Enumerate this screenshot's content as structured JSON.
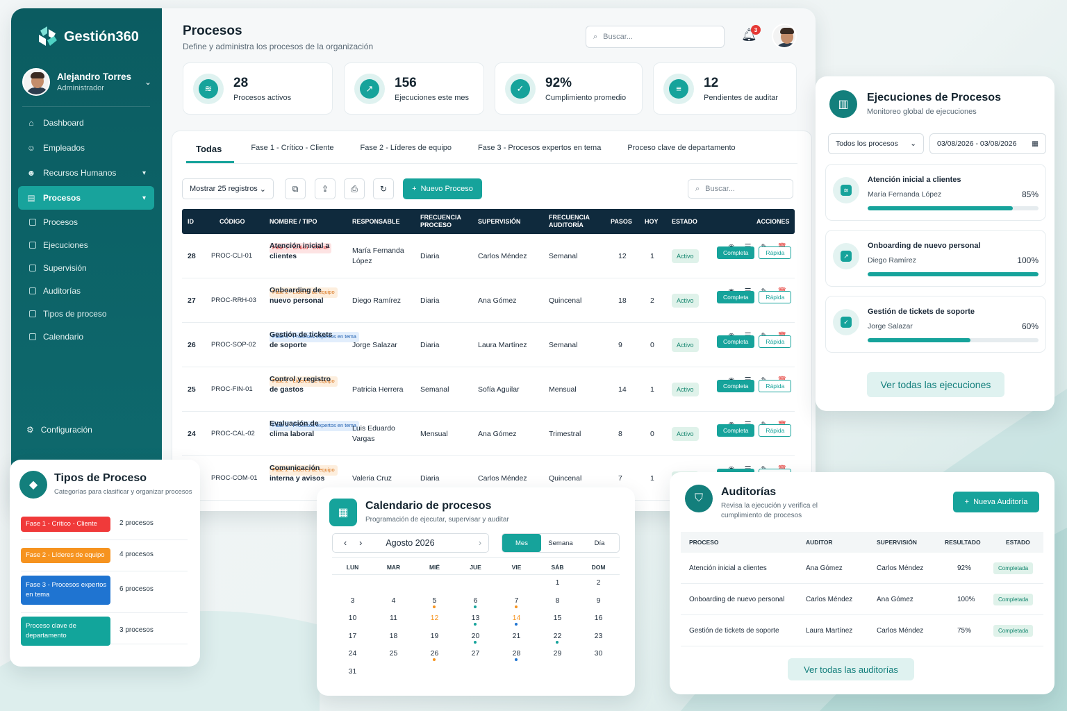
{
  "brand": {
    "name": "Gestión360",
    "accent": "#16a39b",
    "dark": "#0b5c61"
  },
  "user": {
    "name": "Alejandro Torres",
    "role": "Administrador"
  },
  "nav": [
    {
      "label": "Dashboard",
      "icon": "home-icon"
    },
    {
      "label": "Empleados",
      "icon": "users-icon"
    },
    {
      "label": "Recursos Humanos",
      "icon": "hr-icon"
    },
    {
      "label": "Procesos",
      "icon": "process-icon",
      "active": true
    }
  ],
  "subnav": [
    "Procesos",
    "Ejecuciones",
    "Supervisión",
    "Auditorías",
    "Tipos de proceso",
    "Calendario"
  ],
  "config_label": "Configuración",
  "header": {
    "title": "Procesos",
    "subtitle": "Define y administra los procesos de la organización",
    "search_placeholder": "Buscar...",
    "notifications": "3"
  },
  "stats": [
    {
      "value": "28",
      "label": "Procesos activos"
    },
    {
      "value": "156",
      "label": "Ejecuciones este mes"
    },
    {
      "value": "92%",
      "label": "Cumplimiento promedio"
    },
    {
      "value": "12",
      "label": "Pendientes de auditar"
    }
  ],
  "tabs": [
    "Todas",
    "Fase 1 - Crítico - Cliente",
    "Fase 2 - Líderes de equipo",
    "Fase 3 - Procesos expertos en tema",
    "Proceso clave de departamento"
  ],
  "toolbar": {
    "show": "Mostrar 25 registros",
    "new_button": "Nuevo Proceso",
    "search_placeholder": "Buscar..."
  },
  "table": {
    "headers": [
      "ID",
      "CÓDIGO",
      "NOMBRE / TIPO",
      "RESPONSABLE",
      "FRECUENCIA PROCESO",
      "SUPERVISIÓN",
      "FRECUENCIA AUDITORÍA",
      "PASOS",
      "HOY",
      "ESTADO",
      "ACCIONES"
    ],
    "rows": [
      {
        "id": "28",
        "code": "PROC-CLI-01",
        "name": "Atención inicial a clientes",
        "tag": "Fase 1 - Crítico - Cliente",
        "tagc": "red",
        "resp": "María Fernanda López",
        "freq": "Diaria",
        "sup": "Carlos Méndez",
        "aud": "Semanal",
        "steps": "12",
        "today": "1",
        "status": "Activo"
      },
      {
        "id": "27",
        "code": "PROC-RRH-03",
        "name": "Onboarding de nuevo personal",
        "tag": "Fase 2 - Líderes de equipo",
        "tagc": "orange",
        "resp": "Diego Ramírez",
        "freq": "Diaria",
        "sup": "Ana Gómez",
        "aud": "Quincenal",
        "steps": "18",
        "today": "2",
        "status": "Activo"
      },
      {
        "id": "26",
        "code": "PROC-SOP-02",
        "name": "Gestión de tickets de soporte",
        "tag": "Fase 3 - Procesos expertos en tema",
        "tagc": "blue",
        "resp": "Jorge Salazar",
        "freq": "Diaria",
        "sup": "Laura Martínez",
        "aud": "Semanal",
        "steps": "9",
        "today": "0",
        "status": "Activo"
      },
      {
        "id": "25",
        "code": "PROC-FIN-01",
        "name": "Control y registro de gastos",
        "tag": "Fase 2 - Líderes de equipo",
        "tagc": "orange",
        "resp": "Patricia Herrera",
        "freq": "Semanal",
        "sup": "Sofía Aguilar",
        "aud": "Mensual",
        "steps": "14",
        "today": "1",
        "status": "Activo"
      },
      {
        "id": "24",
        "code": "PROC-CAL-02",
        "name": "Evaluación de clima laboral",
        "tag": "Fase 3 - Procesos expertos en tema",
        "tagc": "blue",
        "resp": "Luis Eduardo Vargas",
        "freq": "Mensual",
        "sup": "Ana Gómez",
        "aud": "Trimestral",
        "steps": "8",
        "today": "0",
        "status": "Activo"
      },
      {
        "id": "",
        "code": "PROC-COM-01",
        "name": "Comunicación interna y avisos",
        "tag": "Fase 2 - Líderes de equipo",
        "tagc": "orange",
        "resp": "Valeria Cruz",
        "freq": "Diaria",
        "sup": "Carlos Méndez",
        "aud": "Quincenal",
        "steps": "7",
        "today": "1",
        "status": "Activo"
      }
    ],
    "btn_complete": "Completa",
    "btn_quick": "Rápida"
  },
  "executions": {
    "title": "Ejecuciones de Procesos",
    "subtitle": "Monitoreo global de ejecuciones",
    "filter": "Todos los procesos",
    "date": "03/08/2026 - 03/08/2026",
    "items": [
      {
        "name": "Atención inicial a clientes",
        "person": "María Fernanda López",
        "pct_label": "85%",
        "pct": 85
      },
      {
        "name": "Onboarding de nuevo personal",
        "person": "Diego Ramírez",
        "pct_label": "100%",
        "pct": 100
      },
      {
        "name": "Gestión de tickets de soporte",
        "person": "Jorge Salazar",
        "pct_label": "60%",
        "pct": 60
      }
    ],
    "view_all": "Ver todas las ejecuciones"
  },
  "types": {
    "title": "Tipos de Proceso",
    "subtitle": "Categorías para clasificar y organizar procesos",
    "items": [
      {
        "label": "Fase 1 - Crítico - Cliente",
        "count": "2 procesos",
        "color": "#f03a3a"
      },
      {
        "label": "Fase 2 - Líderes de equipo",
        "count": "4 procesos",
        "color": "#f6931f"
      },
      {
        "label": "Fase 3 - Procesos expertos en tema",
        "count": "6 procesos",
        "color": "#1f74d1"
      },
      {
        "label": "Proceso clave de departamento",
        "count": "3 procesos",
        "color": "#12a59b"
      }
    ]
  },
  "calendar": {
    "title": "Calendario de procesos",
    "subtitle": "Programación de ejecutar, supervisar y auditar",
    "month": "Agosto 2026",
    "views": [
      "Mes",
      "Semana",
      "Día"
    ],
    "weekdays": [
      "LUN",
      "MAR",
      "MIÉ",
      "JUE",
      "VIE",
      "SÁB",
      "DOM"
    ],
    "weeks": [
      [
        {
          "d": ""
        },
        {
          "d": ""
        },
        {
          "d": ""
        },
        {
          "d": ""
        },
        {
          "d": ""
        },
        {
          "d": "1"
        },
        {
          "d": "2"
        }
      ],
      [
        {
          "d": "3"
        },
        {
          "d": "4"
        },
        {
          "d": "5",
          "dot": "#f6931f"
        },
        {
          "d": "6",
          "dot": "#16a39b"
        },
        {
          "d": "7",
          "dot": "#f6931f"
        },
        {
          "d": "8"
        },
        {
          "d": "9"
        }
      ],
      [
        {
          "d": "10"
        },
        {
          "d": "11"
        },
        {
          "d": "12",
          "hl": "#f6931f"
        },
        {
          "d": "13",
          "dot": "#16a39b"
        },
        {
          "d": "14",
          "hl": "#f6931f",
          "dot": "#1f74d1"
        },
        {
          "d": "15"
        },
        {
          "d": "16"
        }
      ],
      [
        {
          "d": "17"
        },
        {
          "d": "18"
        },
        {
          "d": "19"
        },
        {
          "d": "20",
          "dot": "#16a39b"
        },
        {
          "d": "21"
        },
        {
          "d": "22",
          "dot": "#16a39b"
        },
        {
          "d": "23"
        }
      ],
      [
        {
          "d": "24"
        },
        {
          "d": "25"
        },
        {
          "d": "26",
          "dot": "#f6931f"
        },
        {
          "d": "27"
        },
        {
          "d": "28",
          "dot": "#1f74d1"
        },
        {
          "d": "29"
        },
        {
          "d": "30"
        }
      ],
      [
        {
          "d": "31"
        },
        {
          "d": ""
        },
        {
          "d": ""
        },
        {
          "d": ""
        },
        {
          "d": ""
        },
        {
          "d": ""
        },
        {
          "d": ""
        }
      ]
    ]
  },
  "audits": {
    "title": "Auditorías",
    "subtitle": "Revisa la ejecución y verifica el cumplimiento de procesos",
    "new_button": "Nueva Auditoría",
    "headers": [
      "PROCESO",
      "AUDITOR",
      "SUPERVISIÓN",
      "RESULTADO",
      "ESTADO"
    ],
    "rows": [
      {
        "process": "Atención inicial a clientes",
        "auditor": "Ana Gómez",
        "sup": "Carlos Méndez",
        "result": "92%",
        "status": "Completada"
      },
      {
        "process": "Onboarding de nuevo personal",
        "auditor": "Carlos Méndez",
        "sup": "Ana Gómez",
        "result": "100%",
        "status": "Completada"
      },
      {
        "process": "Gestión de tickets de soporte",
        "auditor": "Laura Martínez",
        "sup": "Carlos Méndez",
        "result": "75%",
        "status": "Completada"
      }
    ],
    "view_all": "Ver todas las auditorías"
  }
}
